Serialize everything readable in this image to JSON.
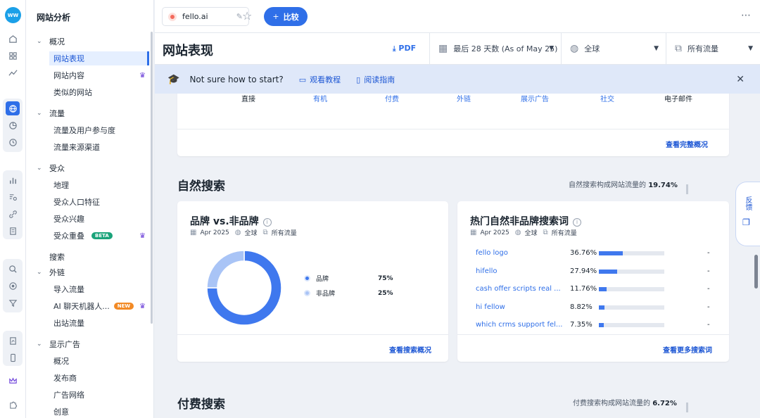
{
  "rail": {
    "logo_text": "WW",
    "icons": [
      "home-icon",
      "dashboard-icon",
      "trend-icon",
      "globe-icon",
      "pie-icon",
      "clock-icon",
      "bar-chart-icon",
      "search-list-icon",
      "link-icon",
      "doc-icon",
      "magnify-icon",
      "target-icon",
      "funnel-icon",
      "report-icon",
      "mobile-icon",
      "crown-icon",
      "puzzle-icon"
    ]
  },
  "sidebar": {
    "title": "网站分析",
    "sections": [
      {
        "label": "概况",
        "items": [
          "网站表现",
          "网站内容",
          "类似的网站"
        ]
      },
      {
        "label": "流量",
        "items": [
          "流量及用户参与度",
          "流量来源渠道"
        ]
      },
      {
        "label": "受众",
        "items": [
          "地理",
          "受众人口特征",
          "受众兴趣",
          "受众重叠"
        ]
      },
      {
        "label": "搜索"
      },
      {
        "label": "外链",
        "items": [
          "导入流量",
          "AI 聊天机器人...",
          "出站流量"
        ]
      },
      {
        "label": "显示广告",
        "items": [
          "概况",
          "发布商",
          "广告网络",
          "创意"
        ]
      }
    ],
    "badges": {
      "beta": "BETA",
      "new": "NEW"
    },
    "crown_glyph": "♛"
  },
  "topbar": {
    "domain": "fello.ai",
    "compare_label": "比较",
    "compare_plus": "+"
  },
  "header": {
    "page_title": "网站表现",
    "pdf_label": "PDF",
    "date_filter": "最后 28 天数 (As of May 25)",
    "region_filter": "全球",
    "traffic_filter": "所有流量"
  },
  "banner": {
    "question": "Not sure how to start?",
    "tutorial_link": "观看教程",
    "guide_link": "阅读指南"
  },
  "channels": {
    "columns": [
      "直接",
      "有机",
      "付费",
      "外链",
      "展示广告",
      "社交",
      "电子邮件"
    ],
    "see_full": "查看完整概况"
  },
  "organic": {
    "section_title": "自然搜索",
    "share_prefix": "自然搜索构成网站流量的",
    "share_value": "19.74%",
    "brand_card": {
      "title": "品牌 vs.非品牌",
      "meta_date": "Apr 2025",
      "meta_region": "全球",
      "meta_traffic": "所有流量",
      "legend": [
        {
          "label": "品牌",
          "value": "75%",
          "color": "#3f78ee"
        },
        {
          "label": "非品牌",
          "value": "25%",
          "color": "#a9c4f6"
        }
      ],
      "footer_link": "查看搜索概况"
    },
    "keywords_card": {
      "title": "热门自然非品牌搜索词",
      "meta_date": "Apr 2025",
      "meta_region": "全球",
      "meta_traffic": "所有流量",
      "rows": [
        {
          "keyword": "fello logo",
          "pct": "36.76%",
          "share": 0.3676,
          "change": "-"
        },
        {
          "keyword": "hifello",
          "pct": "27.94%",
          "share": 0.2794,
          "change": "-"
        },
        {
          "keyword": "cash offer scripts real ...",
          "pct": "11.76%",
          "share": 0.1176,
          "change": "-"
        },
        {
          "keyword": "hi fellow",
          "pct": "8.82%",
          "share": 0.0882,
          "change": "-"
        },
        {
          "keyword": "which crms support fel...",
          "pct": "7.35%",
          "share": 0.0735,
          "change": "-"
        }
      ],
      "footer_link": "查看更多搜索词"
    }
  },
  "paid": {
    "section_title": "付费搜索",
    "share_prefix": "付费搜索构成网站流量的",
    "share_value": "6.72%"
  },
  "feedback_label": "反馈",
  "chart_data": {
    "type": "pie",
    "title": "品牌 vs.非品牌",
    "categories": [
      "品牌",
      "非品牌"
    ],
    "values": [
      75,
      25
    ],
    "colors": [
      "#3f78ee",
      "#a9c4f6"
    ]
  }
}
